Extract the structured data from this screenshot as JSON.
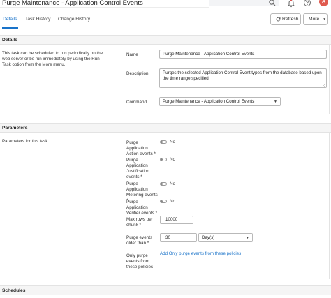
{
  "header": {
    "title": "Purge Maintenance - Application Control Events",
    "avatar_initial": "A"
  },
  "tabs": [
    {
      "label": "Details"
    },
    {
      "label": "Task History"
    },
    {
      "label": "Change History"
    }
  ],
  "toolbar": {
    "refresh_label": "Refresh",
    "more_label": "More",
    "caret": "▼"
  },
  "details": {
    "section_title": "Details",
    "description": "This task can be scheduled to run periodically on the web server or be run immediately by using the Run Task option from the More menu.",
    "name_label": "Name",
    "name_value": "Purge Maintenance - Application Control Events",
    "description_label": "Description",
    "description_value": "Purges the selected Application Control Event types from the database based upon the time range specified",
    "command_label": "Command",
    "command_value": "Purge Maintenance - Application Control Events"
  },
  "parameters": {
    "section_title": "Parameters",
    "description": "Parameters for this task.",
    "action_events_label": "Purge Application Action events *",
    "action_events_value": "No",
    "justification_events_label": "Purge Application Justification events *",
    "justification_events_value": "No",
    "metering_events_label": "Purge Application Metering events *",
    "metering_events_value": "No",
    "verifier_events_label": "Purge Application Verifier events *",
    "verifier_events_value": "No",
    "max_rows_label": "Max rows per chunk *",
    "max_rows_value": "10000",
    "older_than_label": "Purge events older than *",
    "older_than_value": "30",
    "older_than_unit": "Day(s)",
    "policies_label": "Only purge events from these policies",
    "policies_link": "Add Only purge events from these policies"
  },
  "schedules": {
    "section_title": "Schedules"
  }
}
